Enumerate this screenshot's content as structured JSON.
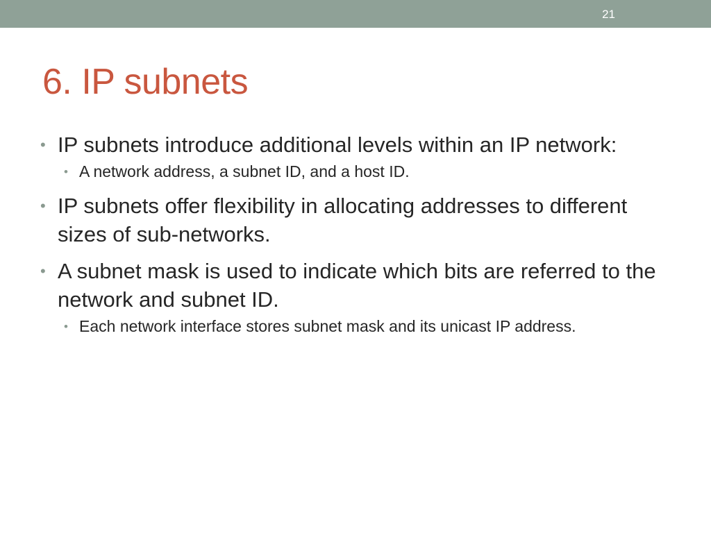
{
  "slide": {
    "number": "21",
    "title": "6. IP subnets",
    "bullets": [
      {
        "level": 1,
        "text": "IP subnets introduce additional levels within an IP network:"
      },
      {
        "level": 2,
        "text": "A network address, a subnet ID, and a host ID."
      },
      {
        "level": 1,
        "text": "IP subnets offer flexibility in allocating addresses to different sizes of sub-networks."
      },
      {
        "level": 1,
        "text": "A subnet mask is used to indicate which bits are referred to the network and subnet ID."
      },
      {
        "level": 2,
        "text": "Each network interface stores subnet mask and its unicast IP address."
      }
    ]
  },
  "colors": {
    "top_bar": "#8fa197",
    "title": "#c9573f",
    "body_text": "#262626",
    "bullet_dot": "#8a9a90"
  }
}
